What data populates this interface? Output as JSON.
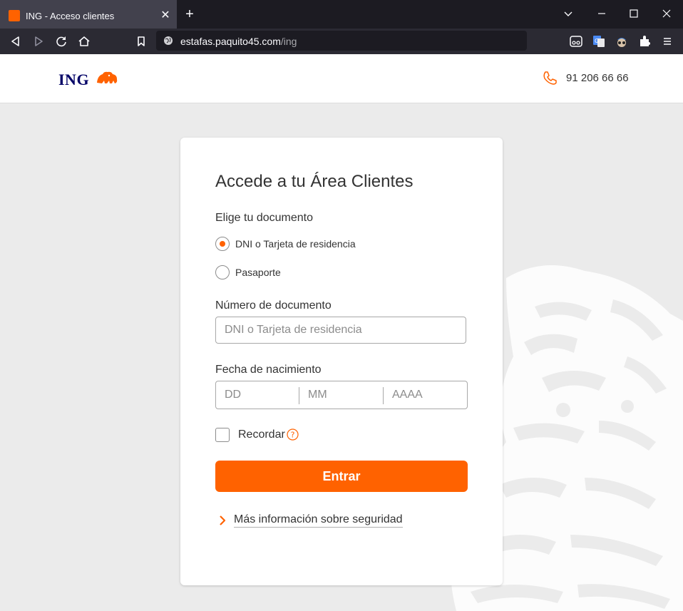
{
  "browser": {
    "tab_title": "ING - Acceso clientes",
    "tab_close_glyph": "✕",
    "new_tab_glyph": "+",
    "url_domain": "estafas.paquito45.com",
    "url_path": "/ing",
    "icons": [
      "back-icon",
      "forward-icon",
      "reload-icon",
      "home-icon",
      "bookmark-icon",
      "globe-icon",
      "minimize-icon",
      "maximize-icon",
      "close-icon",
      "extension-icon",
      "menu-icon"
    ]
  },
  "header": {
    "logo_text": "ING",
    "phone": "91 206 66 66"
  },
  "login": {
    "title": "Accede a tu Área Clientes",
    "document_label": "Elige tu documento",
    "options": [
      {
        "label": "DNI o Tarjeta de residencia",
        "checked": true
      },
      {
        "label": "Pasaporte",
        "checked": false
      }
    ],
    "doc_number_label": "Número de documento",
    "doc_number_placeholder": "DNI o Tarjeta de residencia",
    "birth_label": "Fecha de nacimiento",
    "day_placeholder": "DD",
    "month_placeholder": "MM",
    "year_placeholder": "AAAA",
    "remember_label": "Recordar",
    "remember_checked": false,
    "submit_label": "Entrar",
    "security_link": "Más información sobre seguridad"
  },
  "colors": {
    "accent": "#ff6200",
    "brand_navy": "#000066",
    "page_bg": "#ebebeb",
    "chrome_dark": "#1c1b22"
  }
}
